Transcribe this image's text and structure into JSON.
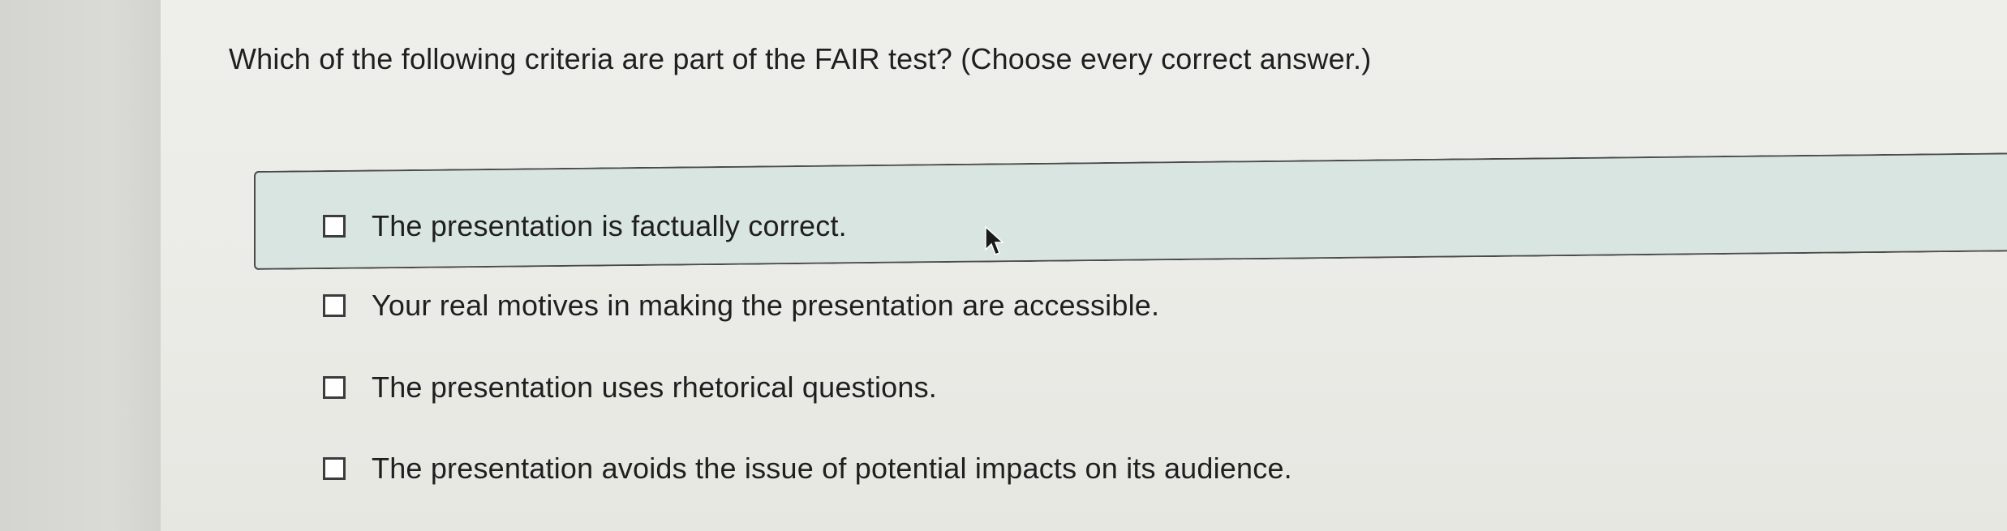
{
  "question": {
    "text": "Which of the following criteria are part of the FAIR test? (Choose every correct answer.)"
  },
  "options": [
    {
      "label": "The presentation is factually correct.",
      "checked": false,
      "highlighted": true
    },
    {
      "label": "Your real motives in making the presentation are accessible.",
      "checked": false,
      "highlighted": false
    },
    {
      "label": "The presentation uses rhetorical questions.",
      "checked": false,
      "highlighted": false
    },
    {
      "label": "The presentation avoids the issue of potential impacts on its audience.",
      "checked": false,
      "highlighted": false
    }
  ],
  "colors": {
    "background": "#e9e9e5",
    "highlight": "#d8e5e0",
    "text": "#1f1f1f"
  },
  "icons": {
    "pointer": "arrow-cursor-icon"
  }
}
